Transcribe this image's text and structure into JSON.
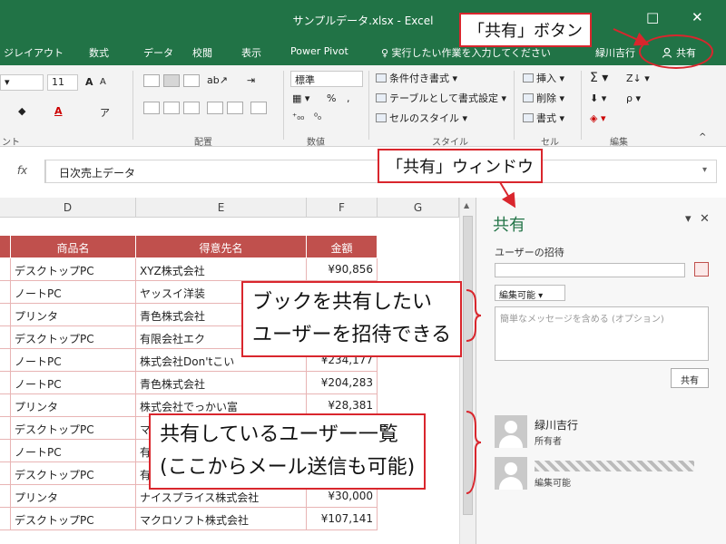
{
  "window": {
    "title": "サンプルデータ.xlsx - Excel",
    "minimize_icon": "□",
    "close_icon": "✕"
  },
  "tabs": [
    "ジレイアウト",
    "数式",
    "データ",
    "校閲",
    "表示",
    "Power Pivot"
  ],
  "tell_me": "♀ 実行したい作業を入力してください",
  "user_name": "緑川吉行",
  "share_button": "共有",
  "ribbon": {
    "font_size": "11",
    "font_grow": "A",
    "font_shrink": "A",
    "number_format": "標準",
    "percent": "%",
    "comma": ",",
    "cond_format": "条件付き書式 ▾",
    "as_table": "テーブルとして書式設定 ▾",
    "cell_style": "セルのスタイル ▾",
    "insert": "挿入 ▾",
    "delete": "削除 ▾",
    "format": "書式 ▾",
    "sum": "Σ ▾",
    "sort": "Z↓ ▾",
    "find": "ρ ▾",
    "groups": [
      "ント",
      "配置",
      "数値",
      "スタイル",
      "セル",
      "編集"
    ]
  },
  "formula_bar": {
    "fx": "fx",
    "value": "日次売上データ"
  },
  "columns": [
    "D",
    "E",
    "F",
    "G"
  ],
  "table": {
    "headers": [
      "商品名",
      "得意先名",
      "金額"
    ],
    "rows": [
      [
        "デスクトップPC",
        "XYZ株式会社",
        "¥90,856"
      ],
      [
        "ノートPC",
        "ヤッスイ洋装",
        ""
      ],
      [
        "プリンタ",
        "青色株式会社",
        ""
      ],
      [
        "デスクトップPC",
        "有限会社エク",
        ""
      ],
      [
        "ノートPC",
        "株式会社Don'tこい",
        "¥234,177"
      ],
      [
        "ノートPC",
        "青色株式会社",
        "¥204,283"
      ],
      [
        "プリンタ",
        "株式会社でっかい富",
        "¥28,381"
      ],
      [
        "デスクトップPC",
        "マ",
        ""
      ],
      [
        "ノートPC",
        "有",
        ""
      ],
      [
        "デスクトップPC",
        "有",
        ""
      ],
      [
        "プリンタ",
        "ナイスプライス株式会社",
        "¥30,000"
      ],
      [
        "デスクトップPC",
        "マクロソフト株式会社",
        "¥107,141"
      ]
    ]
  },
  "share_pane": {
    "title": "共有",
    "pin": "▾",
    "close": "✕",
    "invite_label": "ユーザーの招待",
    "permission": "編集可能 ▾",
    "message_placeholder": "簡単なメッセージを含める (オプション)",
    "share_send": "共有",
    "users": [
      {
        "name": "緑川吉行",
        "role": "所有者"
      },
      {
        "name": "",
        "role": "編集可能"
      }
    ]
  },
  "annotations": {
    "share_button_label": "「共有」ボタン",
    "share_window_label": "「共有」ウィンドウ",
    "invite_line1": "ブックを共有したい",
    "invite_line2": "ユーザーを招待できる",
    "list_line1": "共有しているユーザー一覧",
    "list_line2": "(ここからメール送信も可能)"
  },
  "colors": {
    "excel_green": "#217346",
    "header_red": "#c0504d",
    "annotation_red": "#d9262d"
  }
}
